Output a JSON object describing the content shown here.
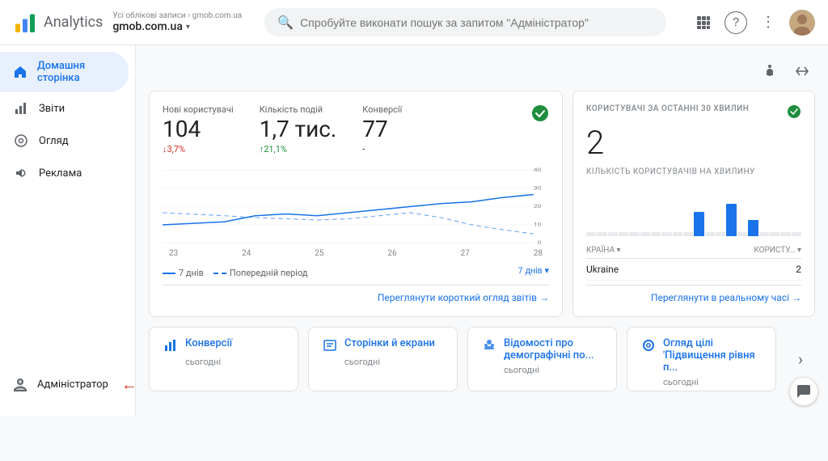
{
  "app": {
    "name": "Analytics",
    "logo_colors": [
      "#f4b400",
      "#db4437",
      "#4285f4",
      "#0f9d58"
    ]
  },
  "header": {
    "breadcrumb": "Усі облікові записи › gmob.com.ua",
    "account_name": "gmob.com.ua",
    "search_placeholder": "Спробуйте виконати пошук за запитом \"Адміністратор\""
  },
  "sidebar": {
    "items": [
      {
        "id": "home",
        "label": "Домашня сторінка",
        "active": true
      },
      {
        "id": "reports",
        "label": "Звіти",
        "active": false
      },
      {
        "id": "explore",
        "label": "Огляд",
        "active": false
      },
      {
        "id": "advertising",
        "label": "Реклама",
        "active": false
      }
    ],
    "admin_label": "Адміністратор"
  },
  "main": {
    "metrics": [
      {
        "label": "Нові користувачі",
        "value": "104",
        "change": "↓3,7%",
        "change_dir": "down"
      },
      {
        "label": "Кількість подій",
        "value": "1,7 тис.",
        "change": "↑21,1%",
        "change_dir": "up"
      },
      {
        "label": "Конверсії",
        "value": "77",
        "change": "-",
        "change_dir": "neutral"
      }
    ],
    "chart": {
      "x_labels": [
        "23",
        "24",
        "25",
        "26",
        "27",
        "28"
      ],
      "y_labels": [
        "40",
        "30",
        "20",
        "10",
        "0"
      ]
    },
    "legend": {
      "period_label": "7 днів",
      "prev_label": "Попередній період"
    },
    "footer_link": "Переглянути короткий огляд звітів →",
    "date_filter": "7 днів ▾"
  },
  "realtime": {
    "title": "КОРИСТУВАЧІ ЗА ОСТАННІ 30 ХВИЛИН",
    "value": "2",
    "chart_title": "КІЛЬКІСТЬ КОРИСТУВАЧІВ НА ХВИЛИНУ",
    "bars": [
      0,
      0,
      0,
      0,
      0,
      0,
      0,
      0,
      0,
      0,
      0,
      0,
      0,
      1,
      0,
      0,
      0,
      2,
      0,
      1,
      0,
      0,
      0,
      0,
      0,
      0,
      0,
      0,
      0,
      0
    ],
    "table_col1": "КРАЇНА ▾",
    "table_col2": "КОРИСТУ... ▾",
    "rows": [
      {
        "country": "Ukraine",
        "users": "2"
      }
    ],
    "footer_link": "Переглянути в реальному часі →"
  },
  "bottom_cards": [
    {
      "id": "conversions",
      "title": "Конверсії",
      "sub": "сьогодні",
      "icon": "bar-chart"
    },
    {
      "id": "pages",
      "title": "Сторінки й екрани",
      "sub": "сьогодні",
      "icon": "monitor"
    },
    {
      "id": "demographics",
      "title": "Відомості про демографічні по...",
      "sub": "сьогодні",
      "icon": "people"
    },
    {
      "id": "goals",
      "title": "Огляд цілі 'Підвищення рівня п...",
      "sub": "сьогодні",
      "icon": "flag"
    }
  ],
  "icons": {
    "search": "🔍",
    "apps_grid": "⠿",
    "help": "?",
    "more_vert": "⋮",
    "home": "⌂",
    "reports": "📊",
    "explore": "◎",
    "advertising": "📢",
    "admin": "⚙",
    "check_circle": "✓",
    "arrow_right": "→",
    "lightbulb": "💡",
    "timeline": "〜"
  }
}
